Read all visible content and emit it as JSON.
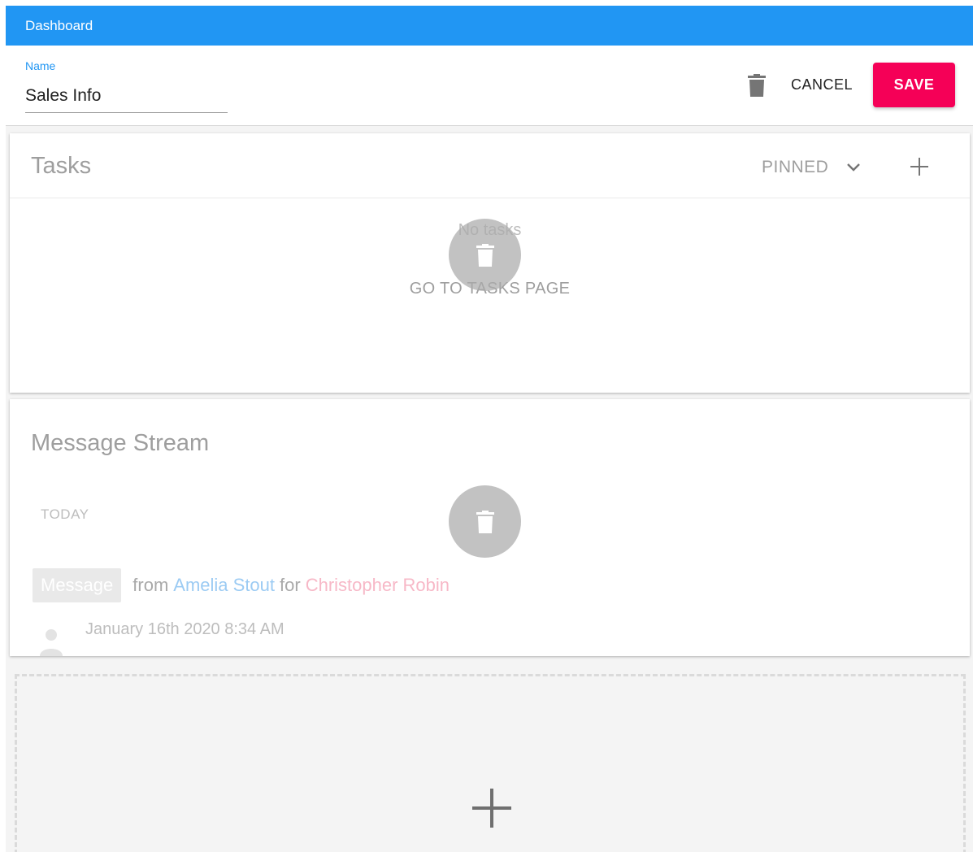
{
  "topbar": {
    "title": "Dashboard"
  },
  "editor": {
    "name_label": "Name",
    "name_value": "Sales Info",
    "delete_icon": "trash-icon",
    "cancel_label": "CANCEL",
    "save_label": "SAVE"
  },
  "tasks": {
    "title": "Tasks",
    "filter_value": "PINNED",
    "add_icon": "plus-icon",
    "empty_text": "No tasks",
    "go_link": "GO TO TASKS PAGE"
  },
  "stream": {
    "title": "Message Stream",
    "day_label": "TODAY",
    "message": {
      "type_chip": "Message",
      "from_word": "from",
      "author": "Amelia Stout",
      "for_word": "for",
      "recipient": "Christopher Robin",
      "timestamp": "January 16th 2020 8:34 AM"
    }
  },
  "add_widget": {
    "icon": "plus-icon"
  },
  "colors": {
    "primary": "#2196f3",
    "accent": "#f50057",
    "author_link": "#9ccbf3",
    "recipient_link": "#f7b8c7"
  }
}
